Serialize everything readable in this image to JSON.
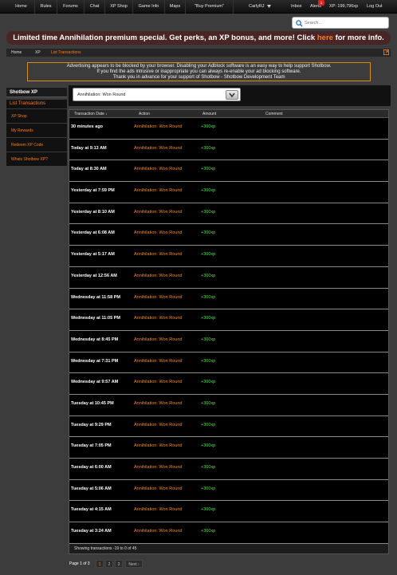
{
  "topnav": {
    "items": [
      "Home",
      "Rules",
      "Forums",
      "Chat",
      "XP Shop",
      "Game Info",
      "Maps",
      "\"Buy Premium\""
    ],
    "user": "CarlyRJ",
    "inbox": "Inbox",
    "alerts": "Alerts",
    "alerts_count": "1",
    "xp": "XP: 199,796xp",
    "logout": "Log Out"
  },
  "search": {
    "placeholder": "Search..."
  },
  "promo": {
    "text_before": "Limited time Annihilation premium special. Get perks, an XP bonus, and more! Click ",
    "link": "here",
    "text_after": " for more info."
  },
  "breadcrumb": [
    "Home",
    "XP",
    "List Transactions"
  ],
  "adblock": {
    "line1": "Advertising appears to be blocked by your browser. Disabling your Adblock software is an easy way to help support Shotbow.",
    "line2": "If you find the ads intrusive or inappropriate you can always re-enable your ad blocking software.",
    "line3": "Thank you in advance for your support of Shotbow - Shotbow Development Team"
  },
  "sidebar": {
    "heading": "Shotbow XP",
    "sub": "List Transactions",
    "items": [
      "XP Shop",
      "My Rewards",
      "Redeem XP Code",
      "Whats Shotbow XP?"
    ]
  },
  "filter": {
    "selected": "Annihilation: Won Round"
  },
  "table": {
    "headers": [
      "Transaction Date ↓",
      "Action",
      "Amount",
      "Comment"
    ],
    "rows": [
      {
        "date": "30 minutes ago",
        "action": "Annihilation: Won Round",
        "amount": "+300xp"
      },
      {
        "date": "Today at 9:13 AM",
        "action": "Annihilation: Won Round",
        "amount": "+300xp"
      },
      {
        "date": "Today at 8:30 AM",
        "action": "Annihilation: Won Round",
        "amount": "+300xp"
      },
      {
        "date": "Yesterday at 7:59 PM",
        "action": "Annihilation: Won Round",
        "amount": "+300xp"
      },
      {
        "date": "Yesterday at 8:10 AM",
        "action": "Annihilation: Won Round",
        "amount": "+300xp"
      },
      {
        "date": "Yesterday at 6:08 AM",
        "action": "Annihilation: Won Round",
        "amount": "+300xp"
      },
      {
        "date": "Yesterday at 5:17 AM",
        "action": "Annihilation: Won Round",
        "amount": "+300xp"
      },
      {
        "date": "Yesterday at 12:56 AM",
        "action": "Annihilation: Won Round",
        "amount": "+300xp"
      },
      {
        "date": "Wednesday at 11:58 PM",
        "action": "Annihilation: Won Round",
        "amount": "+300xp"
      },
      {
        "date": "Wednesday at 11:05 PM",
        "action": "Annihilation: Won Round",
        "amount": "+300xp"
      },
      {
        "date": "Wednesday at 8:45 PM",
        "action": "Annihilation: Won Round",
        "amount": "+300xp"
      },
      {
        "date": "Wednesday at 7:31 PM",
        "action": "Annihilation: Won Round",
        "amount": "+300xp"
      },
      {
        "date": "Wednesday at 9:57 AM",
        "action": "Annihilation: Won Round",
        "amount": "+300xp"
      },
      {
        "date": "Tuesday at 10:45 PM",
        "action": "Annihilation: Won Round",
        "amount": "+300xp"
      },
      {
        "date": "Tuesday at 9:29 PM",
        "action": "Annihilation: Won Round",
        "amount": "+300xp"
      },
      {
        "date": "Tuesday at 7:05 PM",
        "action": "Annihilation: Won Round",
        "amount": "+300xp"
      },
      {
        "date": "Tuesday at 6:00 AM",
        "action": "Annihilation: Won Round",
        "amount": "+300xp"
      },
      {
        "date": "Tuesday at 5:06 AM",
        "action": "Annihilation: Won Round",
        "amount": "+300xp"
      },
      {
        "date": "Tuesday at 4:15 AM",
        "action": "Annihilation: Won Round",
        "amount": "+300xp"
      },
      {
        "date": "Tuesday at 3:24 AM",
        "action": "Annihilation: Won Round",
        "amount": "+300xp"
      }
    ],
    "footer": "Showing transactions -19 to 0 of 45"
  },
  "pagination": {
    "label": "Page 1 of 3",
    "pages": [
      "1",
      "2",
      "3"
    ],
    "next": "Next ›"
  },
  "colors": {
    "accent": "#ff7a1a",
    "xp_green": "#3ee83e",
    "promo_bg": "#4a2525"
  }
}
